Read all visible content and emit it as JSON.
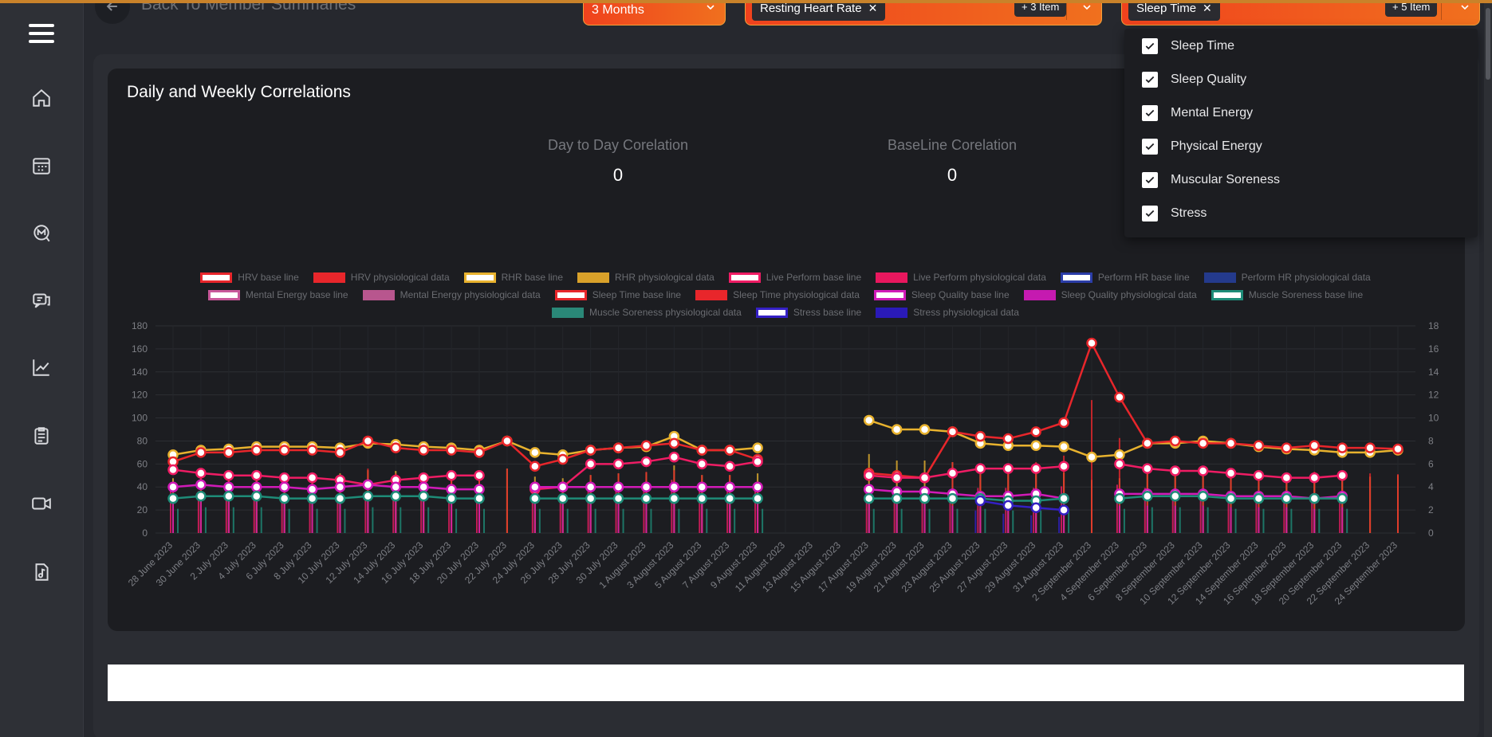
{
  "header": {
    "back_label": "Back To Member Summaries",
    "period": "3 Months",
    "metric_chip": "Resting Heart Rate",
    "metric_more": "+ 3 Item",
    "wellness_chip": "Sleep Time",
    "wellness_more": "+ 5 Item",
    "accent": "#f0421d"
  },
  "sidebar": {
    "items": [
      {
        "icon": "home-icon"
      },
      {
        "icon": "calendar-icon"
      },
      {
        "icon": "chat-m-icon"
      },
      {
        "icon": "messages-icon"
      },
      {
        "icon": "trend-chart-icon"
      },
      {
        "icon": "clipboard-icon"
      },
      {
        "icon": "video-icon"
      },
      {
        "icon": "music-file-icon"
      }
    ]
  },
  "card": {
    "title": "Daily and Weekly Correlations",
    "day_to_day_label": "Day to Day Corelation",
    "day_to_day_value": "0",
    "baseline_label": "BaseLine Corelation",
    "baseline_value": "0"
  },
  "dropdown": {
    "options": [
      {
        "label": "Sleep Time",
        "checked": true
      },
      {
        "label": "Sleep Quality",
        "checked": true
      },
      {
        "label": "Mental Energy",
        "checked": true
      },
      {
        "label": "Physical Energy",
        "checked": true
      },
      {
        "label": "Muscular Soreness",
        "checked": true
      },
      {
        "label": "Stress",
        "checked": true
      }
    ]
  },
  "legend": [
    {
      "label": "HRV base line",
      "color": "#e8262b",
      "style": "outline"
    },
    {
      "label": "HRV physiological data",
      "color": "#e8262b",
      "style": "fill"
    },
    {
      "label": "RHR base line",
      "color": "#e8b22e",
      "style": "outline"
    },
    {
      "label": "RHR physiological data",
      "color": "#d9a12a",
      "style": "fill"
    },
    {
      "label": "Live Perform base line",
      "color": "#ef1c64",
      "style": "outline"
    },
    {
      "label": "Live Perform physiological data",
      "color": "#e8175e",
      "style": "fill"
    },
    {
      "label": "Perform HR base line",
      "color": "#2b3da8",
      "style": "outline"
    },
    {
      "label": "Perform HR physiological data",
      "color": "#243a8c",
      "style": "fill"
    },
    {
      "label": "Mental Energy base line",
      "color": "#c8589a",
      "style": "outline"
    },
    {
      "label": "Mental Energy physiological data",
      "color": "#b8568e",
      "style": "fill"
    },
    {
      "label": "Sleep Time base line",
      "color": "#e8262b",
      "style": "outline"
    },
    {
      "label": "Sleep Time physiological data",
      "color": "#e8262b",
      "style": "fill"
    },
    {
      "label": "Sleep Quality  base line",
      "color": "#d11ab8",
      "style": "outline"
    },
    {
      "label": "Sleep Quality physiological data",
      "color": "#c51ab0",
      "style": "fill"
    },
    {
      "label": "Muscle Soreness base line",
      "color": "#1e8c78",
      "style": "outline"
    },
    {
      "label": "Muscle Soreness physiological data",
      "color": "#2a8878",
      "style": "fill"
    },
    {
      "label": "Stress  base line",
      "color": "#3420c4",
      "style": "outline"
    },
    {
      "label": "Stress physiological data",
      "color": "#2a1ab8",
      "style": "fill"
    }
  ],
  "chart_data": {
    "type": "line",
    "ylim_left": [
      0,
      180
    ],
    "ylim_right": [
      0,
      18
    ],
    "yticks_left": [
      0,
      20,
      40,
      60,
      80,
      100,
      120,
      140,
      160,
      180
    ],
    "yticks_right": [
      0,
      2,
      4,
      6,
      8,
      10,
      12,
      14,
      16,
      18
    ],
    "grid": true,
    "legend_position": "top",
    "x": [
      "28 June 2023",
      "30 June 2023",
      "2 July 2023",
      "4 July 2023",
      "6 July 2023",
      "8 July 2023",
      "10 July 2023",
      "12 July 2023",
      "14 July 2023",
      "16 July 2023",
      "18 July 2023",
      "20 July 2023",
      "22 July 2023",
      "24 July 2023",
      "26 July 2023",
      "28 July 2023",
      "30 July 2023",
      "1 August 2023",
      "3 August 2023",
      "5 August 2023",
      "7 August 2023",
      "9 August 2023",
      "11 August 2023",
      "13 August 2023",
      "15 August 2023",
      "17 August 2023",
      "19 August 2023",
      "21 August 2023",
      "23 August 2023",
      "25 August 2023",
      "27 August 2023",
      "29 August 2023",
      "31 August 2023",
      "2 September 2023",
      "4 September 2023",
      "6 September 2023",
      "8 September 2023",
      "10 September 2023",
      "12 September 2023",
      "14 September 2023",
      "16 September 2023",
      "18 September 2023",
      "20 September 2023",
      "22 September 2023",
      "24 September 2023"
    ],
    "series": [
      {
        "name": "RHR physiological data",
        "color": "#e8b22e",
        "values": [
          68,
          72,
          73,
          75,
          75,
          75,
          74,
          78,
          77,
          75,
          74,
          72,
          80,
          70,
          68,
          72,
          74,
          75,
          84,
          72,
          72,
          74,
          null,
          null,
          null,
          98,
          90,
          90,
          88,
          78,
          76,
          76,
          75,
          66,
          68,
          78,
          78,
          80,
          78,
          75,
          73,
          72,
          70,
          70,
          72
        ]
      },
      {
        "name": "HRV physiological data",
        "color": "#e8262b",
        "values": [
          62,
          70,
          70,
          72,
          72,
          72,
          70,
          80,
          74,
          72,
          72,
          70,
          80,
          58,
          64,
          72,
          74,
          76,
          78,
          72,
          72,
          64,
          null,
          null,
          null,
          52,
          50,
          48,
          88,
          84,
          82,
          88,
          96,
          165,
          118,
          78,
          80,
          78,
          78,
          76,
          74,
          76,
          74,
          74,
          73
        ]
      },
      {
        "name": "Live Perform physiological data",
        "color": "#ef1c64",
        "values": [
          55,
          52,
          50,
          50,
          48,
          48,
          46,
          42,
          46,
          48,
          50,
          50,
          null,
          38,
          40,
          60,
          60,
          62,
          66,
          60,
          58,
          62,
          null,
          null,
          null,
          50,
          48,
          48,
          52,
          56,
          56,
          56,
          58,
          null,
          60,
          56,
          54,
          54,
          52,
          50,
          48,
          48,
          50,
          null,
          null
        ]
      },
      {
        "name": "Sleep Quality physiological data",
        "color": "#d11ab8",
        "values": [
          40,
          42,
          40,
          40,
          40,
          38,
          40,
          42,
          40,
          40,
          38,
          38,
          null,
          40,
          40,
          40,
          40,
          40,
          40,
          40,
          40,
          40,
          null,
          null,
          null,
          38,
          36,
          36,
          34,
          32,
          32,
          34,
          30,
          null,
          34,
          34,
          34,
          34,
          32,
          32,
          32,
          30,
          32,
          null,
          null
        ]
      },
      {
        "name": "Muscle Soreness physiological data",
        "color": "#1e8c78",
        "values": [
          30,
          32,
          32,
          32,
          30,
          30,
          30,
          32,
          32,
          32,
          30,
          30,
          null,
          30,
          30,
          30,
          30,
          30,
          30,
          30,
          30,
          30,
          null,
          null,
          null,
          30,
          30,
          30,
          30,
          30,
          28,
          28,
          30,
          null,
          30,
          32,
          32,
          32,
          30,
          30,
          30,
          30,
          30,
          null,
          null
        ]
      },
      {
        "name": "Stress physiological data",
        "color": "#3420c4",
        "values": [
          null,
          null,
          null,
          null,
          null,
          null,
          null,
          null,
          null,
          null,
          null,
          null,
          null,
          null,
          null,
          null,
          null,
          null,
          null,
          null,
          null,
          null,
          null,
          null,
          null,
          null,
          null,
          null,
          null,
          28,
          24,
          22,
          20,
          null,
          null,
          null,
          null,
          null,
          null,
          null,
          null,
          null,
          null,
          null,
          null
        ]
      }
    ]
  }
}
